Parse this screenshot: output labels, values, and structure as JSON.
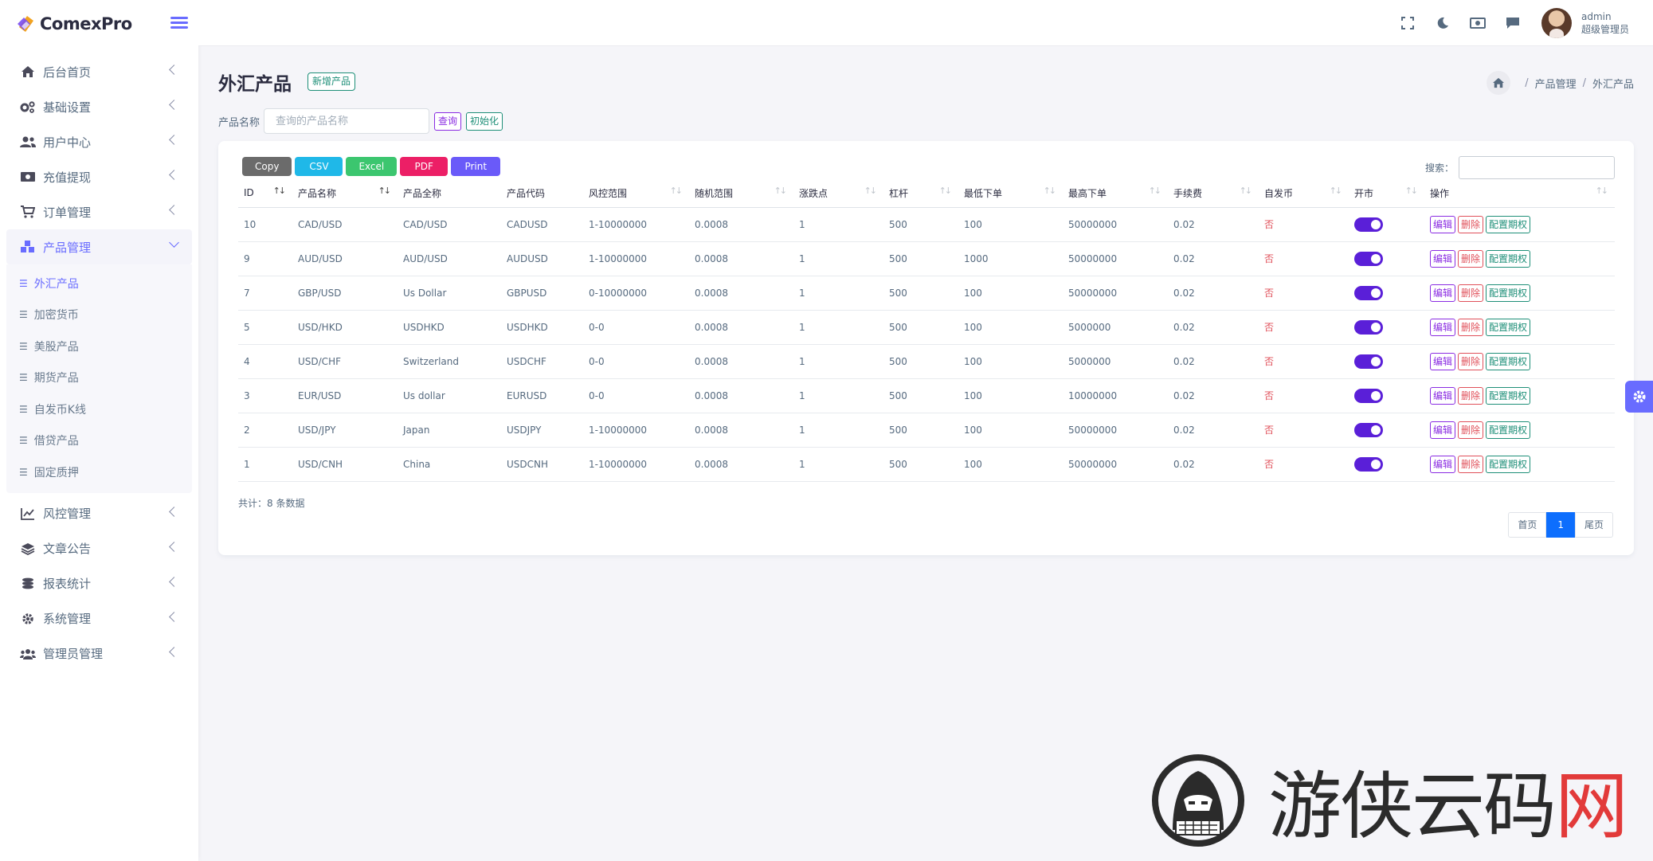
{
  "brand": {
    "name": "ComexPro"
  },
  "sidebar": {
    "items": [
      {
        "label": "后台首页",
        "icon": "home-icon"
      },
      {
        "label": "基础设置",
        "icon": "gears-icon"
      },
      {
        "label": "用户中心",
        "icon": "users-icon"
      },
      {
        "label": "充值提现",
        "icon": "money-icon"
      },
      {
        "label": "订单管理",
        "icon": "cart-icon"
      },
      {
        "label": "产品管理",
        "icon": "cubes-icon",
        "open": true
      },
      {
        "label": "风控管理",
        "icon": "chart-line-icon"
      },
      {
        "label": "文章公告",
        "icon": "layers-icon"
      },
      {
        "label": "报表统计",
        "icon": "coins-icon"
      },
      {
        "label": "系统管理",
        "icon": "cog-icon"
      },
      {
        "label": "管理员管理",
        "icon": "user-group-icon"
      }
    ],
    "submenu": [
      {
        "label": "外汇产品",
        "active": true
      },
      {
        "label": "加密货币"
      },
      {
        "label": "美股产品"
      },
      {
        "label": "期货产品"
      },
      {
        "label": "自发币K线"
      },
      {
        "label": "借贷产品"
      },
      {
        "label": "固定质押"
      }
    ]
  },
  "topbar": {
    "user_name": "admin",
    "user_role": "超级管理员",
    "icons": [
      "fullscreen-icon",
      "moon-icon",
      "money-bill-icon",
      "chat-icon"
    ]
  },
  "page": {
    "title": "外汇产品",
    "add_button": "新增产品",
    "breadcrumb": [
      "产品管理",
      "外汇产品"
    ]
  },
  "filter": {
    "label": "产品名称",
    "placeholder": "查询的产品名称",
    "query_button": "查询",
    "reset_button": "初始化"
  },
  "export": {
    "copy": "Copy",
    "csv": "CSV",
    "excel": "Excel",
    "pdf": "PDF",
    "print": "Print"
  },
  "search": {
    "label": "搜索："
  },
  "table": {
    "headers": [
      "ID",
      "产品名称",
      "产品全称",
      "产品代码",
      "风控范围",
      "随机范围",
      "涨跌点",
      "杠杆",
      "最低下单",
      "最高下单",
      "手续费",
      "自发币",
      "开市",
      "操作"
    ],
    "rows": [
      [
        "10",
        "CAD/USD",
        "CAD/USD",
        "CADUSD",
        "1-10000000",
        "0.0008",
        "1",
        "500",
        "100",
        "50000000",
        "0.02",
        "否"
      ],
      [
        "9",
        "AUD/USD",
        "AUD/USD",
        "AUDUSD",
        "1-10000000",
        "0.0008",
        "1",
        "500",
        "1000",
        "50000000",
        "0.02",
        "否"
      ],
      [
        "7",
        "GBP/USD",
        "Us Dollar",
        "GBPUSD",
        "0-10000000",
        "0.0008",
        "1",
        "500",
        "100",
        "50000000",
        "0.02",
        "否"
      ],
      [
        "5",
        "USD/HKD",
        "USDHKD",
        "USDHKD",
        "0-0",
        "0.0008",
        "1",
        "500",
        "100",
        "5000000",
        "0.02",
        "否"
      ],
      [
        "4",
        "USD/CHF",
        "Switzerland",
        "USDCHF",
        "0-0",
        "0.0008",
        "1",
        "500",
        "100",
        "5000000",
        "0.02",
        "否"
      ],
      [
        "3",
        "EUR/USD",
        "Us dollar",
        "EURUSD",
        "0-0",
        "0.0008",
        "1",
        "500",
        "100",
        "10000000",
        "0.02",
        "否"
      ],
      [
        "2",
        "USD/JPY",
        "Japan",
        "USDJPY",
        "1-10000000",
        "0.0008",
        "1",
        "500",
        "100",
        "50000000",
        "0.02",
        "否"
      ],
      [
        "1",
        "USD/CNH",
        "China",
        "USDCNH",
        "1-10000000",
        "0.0008",
        "1",
        "500",
        "100",
        "50000000",
        "0.02",
        "否"
      ]
    ],
    "actions": {
      "edit": "编辑",
      "delete": "删除",
      "options": "配置期权"
    }
  },
  "footer": {
    "total": "共计：8 条数据",
    "pager": {
      "first": "首页",
      "current": "1",
      "last": "尾页"
    }
  },
  "watermark": {
    "text_main": "游侠云码",
    "text_red": "网"
  },
  "colors": {
    "accent": "#696cff",
    "toggle": "#5a1fd8",
    "danger": "#e0505a",
    "success": "#1e8f78",
    "purple": "#8a2be2",
    "page_active": "#0d6efd"
  }
}
